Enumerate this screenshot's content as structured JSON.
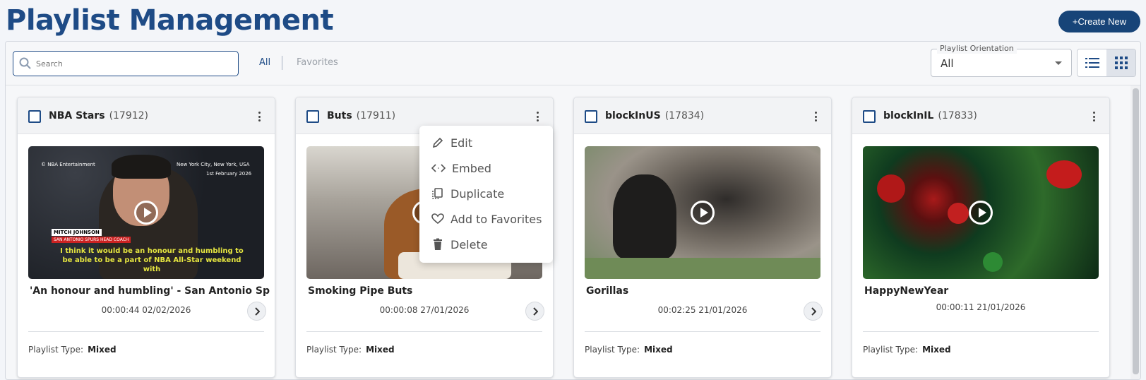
{
  "header": {
    "title": "Playlist Management",
    "create_label": "+Create New"
  },
  "toolbar": {
    "search_placeholder": "Search",
    "filter_all": "All",
    "filter_favorites": "Favorites",
    "orientation_label": "Playlist Orientation",
    "orientation_value": "All",
    "view_list_icon": "list-view-icon",
    "view_grid_icon": "grid-view-icon"
  },
  "cards": [
    {
      "name": "NBA Stars",
      "id": "(17912)",
      "video_title": "'An honour and humbling' - San Antonio Spurs'...",
      "meta": "00:00:44 02/02/2026",
      "type_label": "Playlist Type:",
      "type_value": "Mixed",
      "thumb_overlay": {
        "corner_left": "© NBA Entertainment",
        "location": "New York City, New York, USA",
        "date": "1st February 2026",
        "name_tag": "MITCH JOHNSON",
        "role_tag": "SAN ANTONIO SPURS HEAD COACH",
        "caption": "I think it would be an honour and humbling to be able to be a part of NBA All-Star weekend with"
      }
    },
    {
      "name": "Buts",
      "id": "(17911)",
      "video_title": "Smoking Pipe Buts",
      "meta": "00:00:08 27/01/2026",
      "type_label": "Playlist Type:",
      "type_value": "Mixed"
    },
    {
      "name": "blockInUS",
      "id": "(17834)",
      "video_title": "Gorillas",
      "meta": "00:02:25 21/01/2026",
      "type_label": "Playlist Type:",
      "type_value": "Mixed"
    },
    {
      "name": "blockInIL",
      "id": "(17833)",
      "video_title": "HappyNewYear",
      "meta": "00:00:11 21/01/2026",
      "type_label": "Playlist Type:",
      "type_value": "Mixed"
    }
  ],
  "context_menu": {
    "items": [
      {
        "label": "Edit",
        "icon": "pencil-icon"
      },
      {
        "label": "Embed",
        "icon": "code-icon"
      },
      {
        "label": "Duplicate",
        "icon": "copy-icon"
      },
      {
        "label": "Add to Favorites",
        "icon": "heart-icon"
      },
      {
        "label": "Delete",
        "icon": "trash-icon"
      }
    ]
  },
  "colors": {
    "brand": "#1e4b86",
    "create_button": "#174478"
  }
}
